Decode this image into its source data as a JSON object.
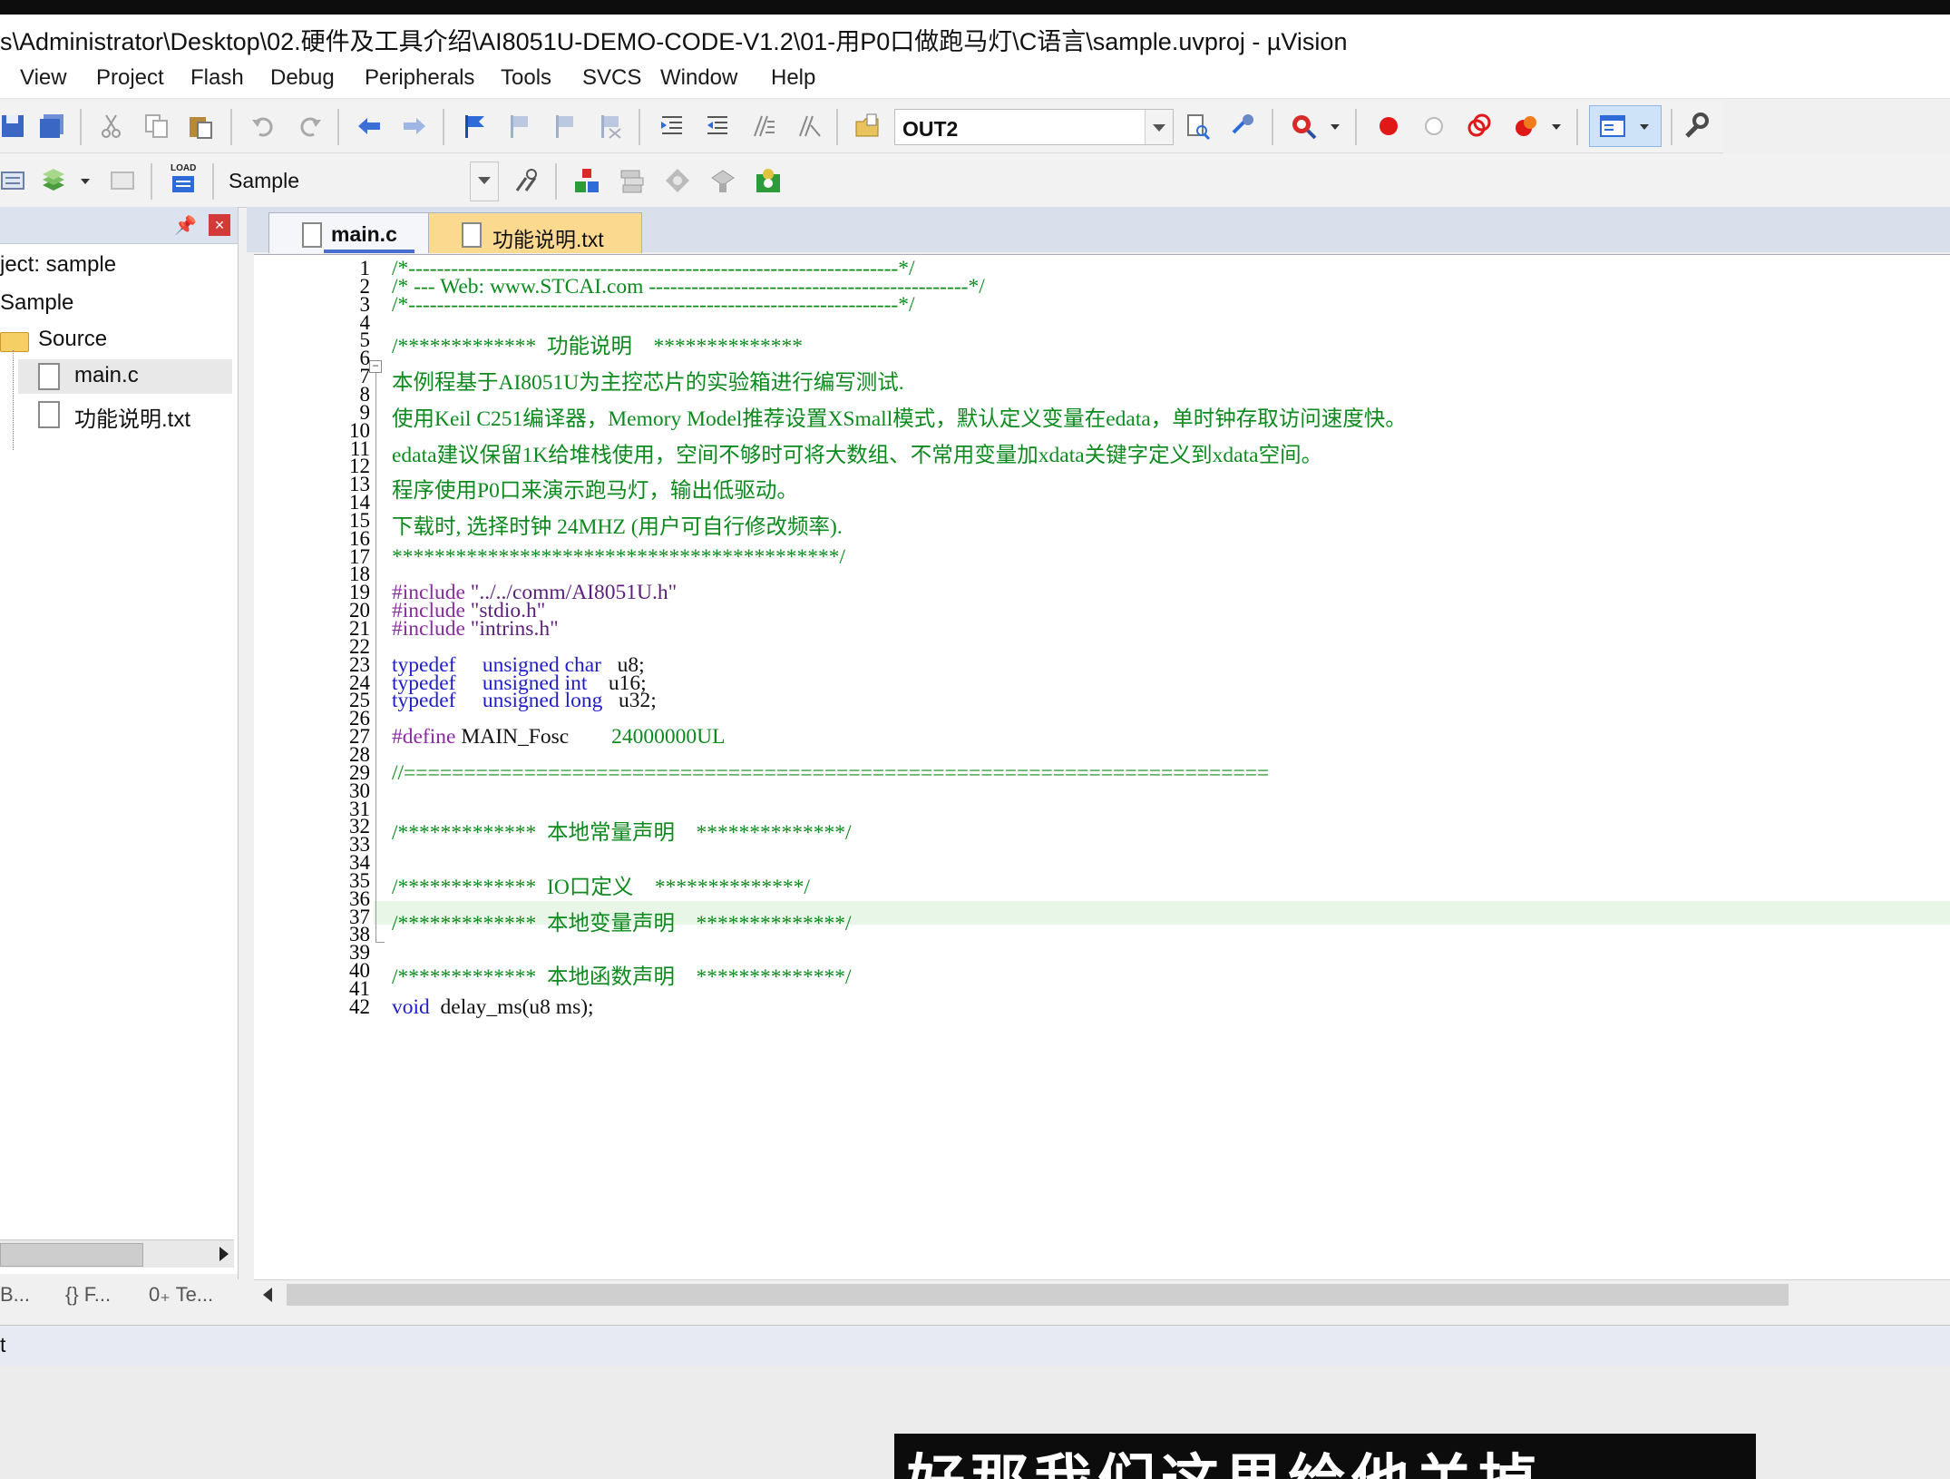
{
  "window": {
    "title": "s\\Administrator\\Desktop\\02.硬件及工具介绍\\AI8051U-DEMO-CODE-V1.2\\01-用P0口做跑马灯\\C语言\\sample.uvproj - µVision"
  },
  "menu": [
    "View",
    "Project",
    "Flash",
    "Debug",
    "Peripherals",
    "Tools",
    "SVCS",
    "Window",
    "Help"
  ],
  "toolbar": {
    "find_combo": "OUT2",
    "target_combo": "Sample",
    "load_label": "LOAD"
  },
  "project": {
    "root": "ject: sample",
    "target": "Sample",
    "group": "Source",
    "files": [
      "main.c",
      "功能说明.txt"
    ],
    "bottom_tabs": [
      "B...",
      "{} F...",
      "0₊ Te..."
    ]
  },
  "editor": {
    "tabs": [
      {
        "label": "main.c",
        "active": false
      },
      {
        "label": "功能说明.txt",
        "active": true
      }
    ],
    "lines": [
      "/*---------------------------------------------------------------------*/",
      "/* --- Web: www.STCAI.com ---------------------------------------------*/",
      "/*---------------------------------------------------------------------*/",
      "",
      "/*************  功能说明    **************",
      "",
      "本例程基于AI8051U为主控芯片的实验箱进行编写测试.",
      "",
      "使用Keil C251编译器，Memory Model推荐设置XSmall模式，默认定义变量在edata，单时钟存取访问速度快。",
      "",
      "edata建议保留1K给堆栈使用，空间不够时可将大数组、不常用变量加xdata关键字定义到xdata空间。",
      "",
      "程序使用P0口来演示跑马灯，输出低驱动。",
      "",
      "下载时, 选择时钟 24MHZ (用户可自行修改频率).",
      "",
      "******************************************/",
      "",
      "#include \"../../comm/AI8051U.h\"",
      "#include \"stdio.h\"",
      "#include \"intrins.h\"",
      "",
      "typedef     unsigned char   u8;",
      "typedef     unsigned int    u16;",
      "typedef     unsigned long   u32;",
      "",
      "#define MAIN_Fosc        24000000UL",
      "",
      "//========================================================================",
      "",
      "",
      "/*************  本地常量声明    **************/",
      "",
      "",
      "/*************  IO口定义    **************/",
      "",
      "/*************  本地变量声明    **************/",
      "",
      "",
      "/*************  本地函数声明    **************/",
      "",
      "void  delay_ms(u8 ms);"
    ]
  },
  "status": {
    "left": "t"
  },
  "subtitle": "好那我们这里给他关掉"
}
